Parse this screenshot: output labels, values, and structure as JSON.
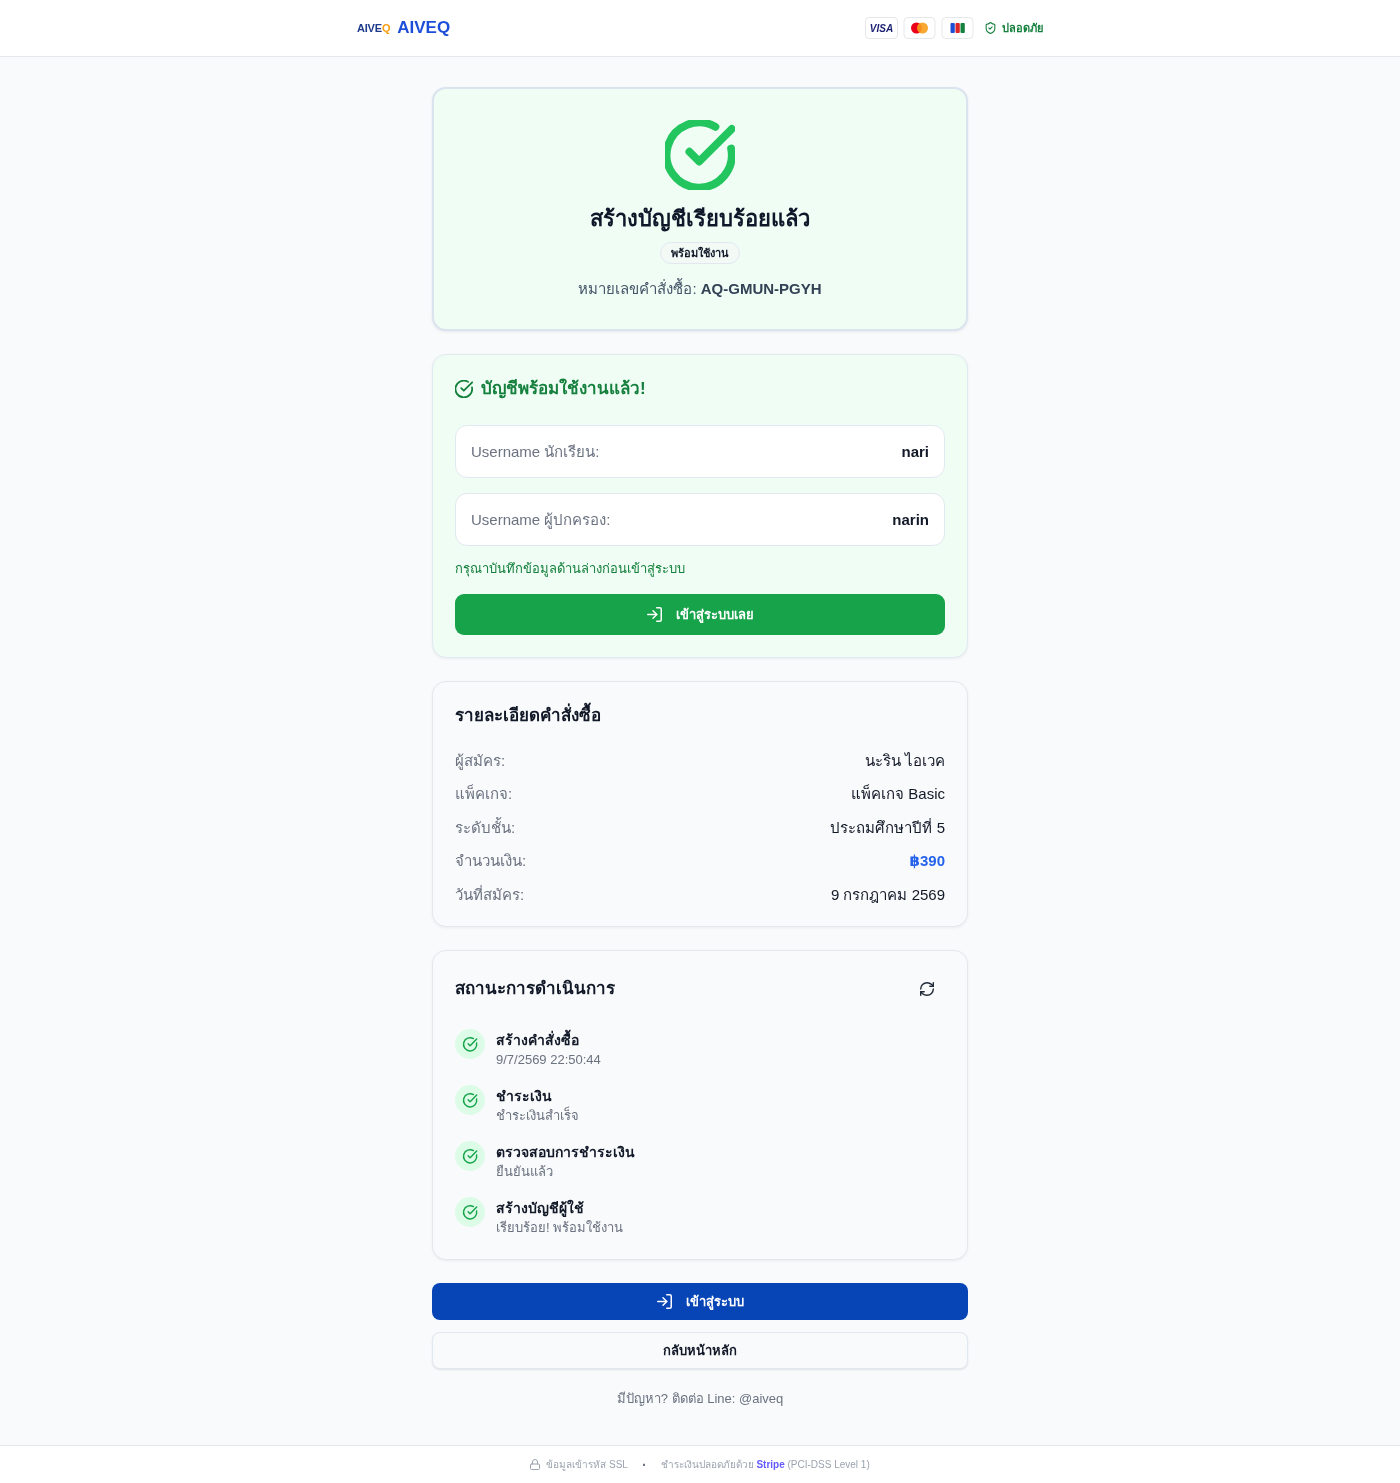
{
  "header": {
    "logo_mark": {
      "text": "AIVE",
      "accent": "Q"
    },
    "brand": "AIVEQ",
    "payment_badges": [
      {
        "kind": "visa",
        "label": "VISA"
      },
      {
        "kind": "mastercard"
      },
      {
        "kind": "jcb"
      }
    ],
    "security": "ปลอดภัย"
  },
  "success_card": {
    "title": "สร้างบัญชีเรียบร้อยแล้ว",
    "badge": "พร้อมใช้งาน",
    "order_number": "หมายเลขคำสั่งซื้อ: **AQ-GMUN-PGYH**"
  },
  "account_card": {
    "heading": "บัญชีพร้อมใช้งานแล้ว!",
    "credentials": [
      {
        "label": "Username นักเรียน:",
        "value": "nari"
      },
      {
        "label": "Username ผู้ปกครอง:",
        "value": "narin"
      }
    ],
    "note": "กรุณาบันทึกข้อมูลด้านล่างก่อนเข้าสู่ระบบ",
    "button": "เข้าสู่ระบบเลย"
  },
  "order_details": {
    "title": "รายละเอียดคำสั่งซื้อ",
    "rows": [
      {
        "label": "ผู้สมัคร:",
        "value": "นะริน ไอเวค",
        "kind": "text"
      },
      {
        "label": "แพ็คเกจ:",
        "value": "แพ็คเกจ Basic",
        "kind": "text"
      },
      {
        "label": "ระดับชั้น:",
        "value": "ประถมศึกษาปีที่ 5",
        "kind": "text"
      },
      {
        "label": "จำนวนเงิน:",
        "value": "฿390",
        "kind": "amount"
      },
      {
        "label": "วันที่สมัคร:",
        "value": "9 กรกฎาคม 2569",
        "kind": "text"
      }
    ]
  },
  "status": {
    "title": "สถานะการดำเนินการ",
    "steps": [
      {
        "title": "สร้างคำสั่งซื้อ",
        "detail": "9/7/2569 22:50:44",
        "completed": true
      },
      {
        "title": "ชำระเงิน",
        "detail": "ชำระเงินสำเร็จ",
        "completed": true
      },
      {
        "title": "ตรวจสอบการชำระเงิน",
        "detail": "ยืนยันแล้ว",
        "completed": true
      },
      {
        "title": "สร้างบัญชีผู้ใช้",
        "detail": "เรียบร้อย! พร้อมใช้งาน",
        "completed": true
      }
    ]
  },
  "actions": [
    {
      "kind": "primary",
      "label": "เข้าสู่ระบบ"
    },
    {
      "kind": "secondary",
      "label": "กลับหน้าหลัก"
    }
  ],
  "help": "มีปัญหา? ติดต่อ Line: @aiveq",
  "footer": {
    "ssl": "ข้อมูลเข้ารหัส SSL",
    "separator": "·",
    "payment": "ชำระเงินปลอดภัยด้วย **Stripe** (PCI-DSS Level 1)"
  }
}
